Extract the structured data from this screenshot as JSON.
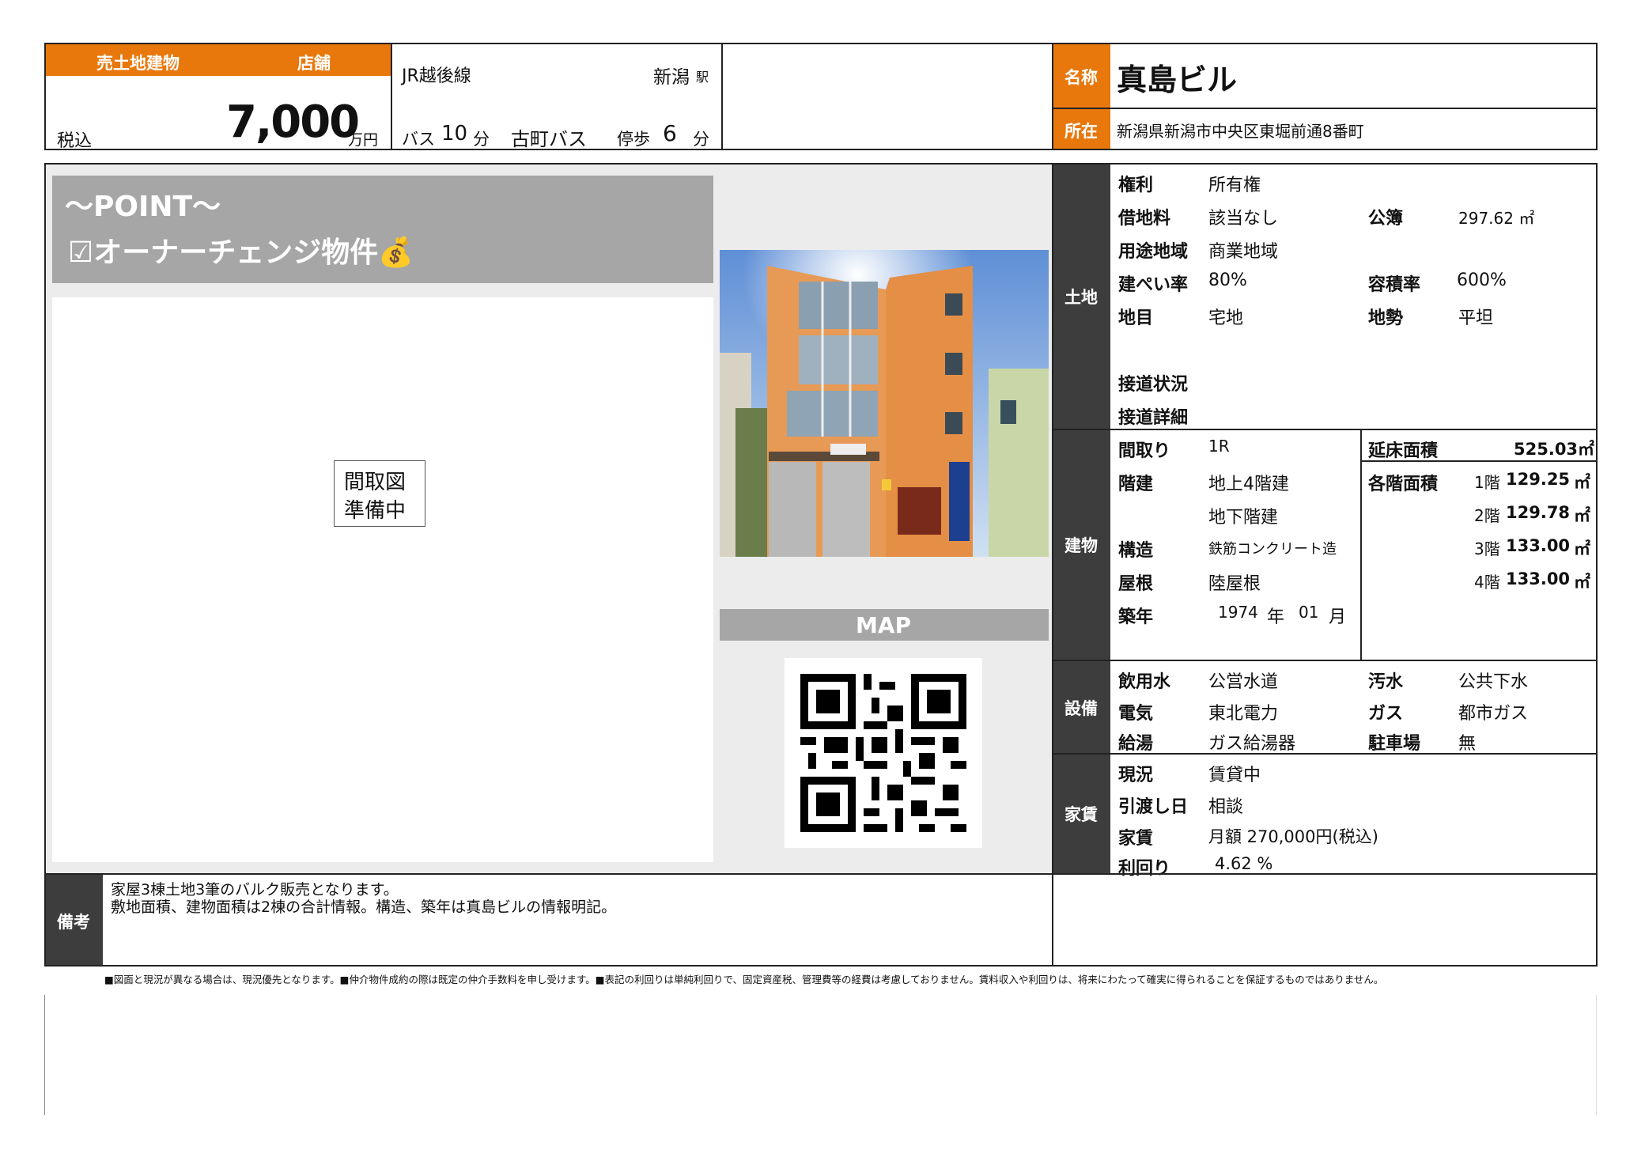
{
  "header": {
    "category": "売土地建物",
    "type": "店舗",
    "tax_label": "税込",
    "price": "7,000",
    "price_unit": "万円",
    "line": "JR越後線",
    "station": "新潟",
    "station_suffix": "駅",
    "bus_label": "バス",
    "bus_min": "10",
    "bus_unit": "分",
    "bus_stop": "古町バス",
    "walk_label": "停歩",
    "walk_min": "6",
    "walk_unit": "分",
    "name_label": "名称",
    "name": "真島ビル",
    "address_label": "所在",
    "address": "新潟県新潟市中央区東堀前通8番町"
  },
  "point": {
    "title": "～POINT～",
    "item": "☑オーナーチェンジ物件💰"
  },
  "floorplan": {
    "line1": "間取図",
    "line2": "準備中"
  },
  "map": {
    "label": "MAP"
  },
  "land": {
    "section": "土地",
    "rights_label": "権利",
    "rights": "所有権",
    "lease_label": "借地料",
    "lease": "該当なし",
    "area_label": "公簿",
    "area": "297.62 ㎡",
    "zone_label": "用途地域",
    "zone": "商業地域",
    "bcr_label": "建ぺい率",
    "bcr": "80%",
    "far_label": "容積率",
    "far": "600%",
    "category_label": "地目",
    "category": "宅地",
    "terrain_label": "地勢",
    "terrain": "平坦",
    "road_label": "接道状況",
    "road_detail_label": "接道詳細"
  },
  "building": {
    "section": "建物",
    "layout_label": "間取り",
    "layout": "1R",
    "floor_area_label": "延床面積",
    "floor_area": "525.03㎡",
    "floors_label": "階建",
    "floors_above": "地上4階建",
    "floors_below": "地下階建",
    "each_floor_label": "各階面積",
    "each_floor": [
      {
        "floor": "1階",
        "area": "129.25",
        "unit": "㎡"
      },
      {
        "floor": "2階",
        "area": "129.78",
        "unit": "㎡"
      },
      {
        "floor": "3階",
        "area": "133.00",
        "unit": "㎡"
      },
      {
        "floor": "4階",
        "area": "133.00",
        "unit": "㎡"
      }
    ],
    "structure_label": "構造",
    "structure": "鉄筋コンクリート造",
    "roof_label": "屋根",
    "roof": "陸屋根",
    "built_label": "築年",
    "built_year": "1974",
    "year_unit": "年",
    "built_month": "01",
    "month_unit": "月"
  },
  "facilities": {
    "section": "設備",
    "water_label": "飲用水",
    "water": "公営水道",
    "sewage_label": "汚水",
    "sewage": "公共下水",
    "power_label": "電気",
    "power": "東北電力",
    "gas_label": "ガス",
    "gas": "都市ガス",
    "hotwater_label": "給湯",
    "hotwater": "ガス給湯器",
    "parking_label": "駐車場",
    "parking": "無"
  },
  "rent": {
    "section": "家賃",
    "status_label": "現況",
    "status": "賃貸中",
    "handover_label": "引渡し日",
    "handover": "相談",
    "rent_label": "家賃",
    "rent": "月額 270,000円(税込)",
    "yield_label": "利回り",
    "yield": "4.62 %"
  },
  "remarks": {
    "label": "備考",
    "line1": "家屋3棟土地3筆のバルク販売となります。",
    "line2": "敷地面積、建物面積は2棟の合計情報。構造、築年は真島ビルの情報明記。"
  },
  "footer": "■図面と現況が異なる場合は、現況優先となります。■仲介物件成約の際は既定の仲介手数料を申し受けます。■表記の利回りは単純利回りで、固定資産税、管理費等の経費は考慮しておりません。賃料収入や利回りは、将来にわたって確実に得られることを保証するものではありません。",
  "colors": {
    "accent": "#e8780c",
    "section_bg": "#3d3d3d"
  }
}
